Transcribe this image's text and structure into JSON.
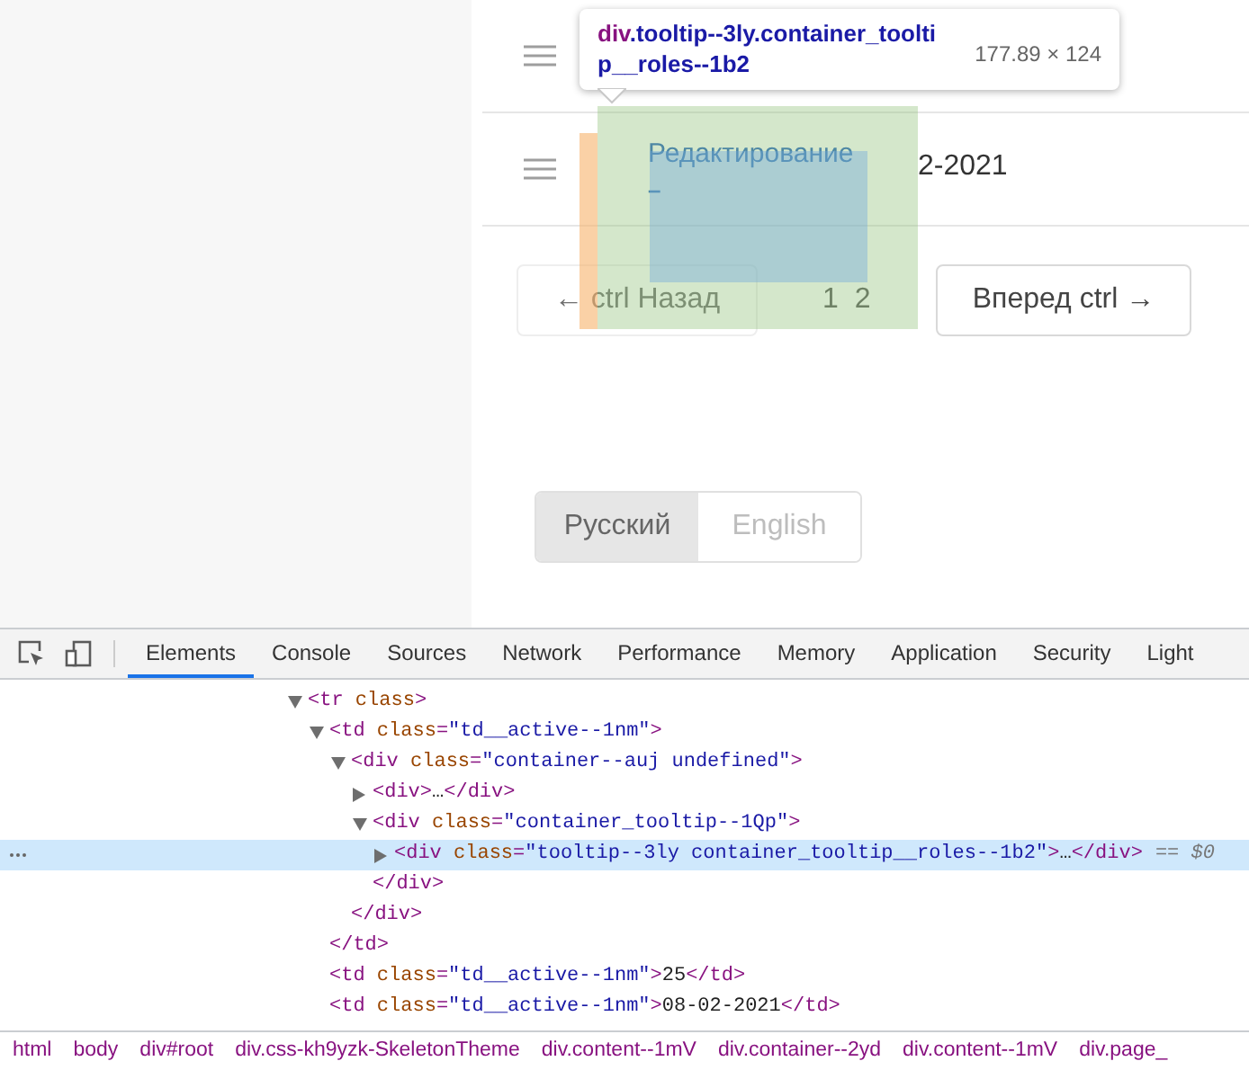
{
  "page": {
    "rows": [
      {
        "cell_title": null,
        "cell_note": null,
        "date_fragment": null
      },
      {
        "cell_title": "Редактирование",
        "cell_note": "–",
        "date_fragment": "2-2021"
      }
    ],
    "pagination": {
      "prev": {
        "label": "← ctrl Назад",
        "disabled": true
      },
      "pages": [
        "1",
        "2"
      ],
      "next": {
        "label": "Вперед ctrl →",
        "disabled": false
      }
    },
    "languages": [
      {
        "label": "Русский",
        "selected": true
      },
      {
        "label": "English",
        "selected": false
      }
    ]
  },
  "inspect_tooltip": {
    "tag": "div",
    "classes": ".tooltip--3ly.container_tooltip__roles--1b2",
    "size": "177.89 × 124"
  },
  "devtools": {
    "tabs": [
      {
        "label": "Elements",
        "selected": true
      },
      {
        "label": "Console",
        "selected": false
      },
      {
        "label": "Sources",
        "selected": false
      },
      {
        "label": "Network",
        "selected": false
      },
      {
        "label": "Performance",
        "selected": false
      },
      {
        "label": "Memory",
        "selected": false
      },
      {
        "label": "Application",
        "selected": false
      },
      {
        "label": "Security",
        "selected": false
      },
      {
        "label": "Light",
        "selected": false
      }
    ],
    "tree": [
      {
        "text": "<tr class>",
        "expanded": true,
        "selected": false,
        "children": [
          {
            "text": "<td class=\"td__active--1nm\">",
            "expanded": true,
            "selected": false,
            "close": "</td>",
            "children": [
              {
                "text": "<div class=\"container--auj undefined\">",
                "expanded": true,
                "selected": false,
                "close": "</div>",
                "children": [
                  {
                    "text": "<div>…</div>",
                    "expanded": false,
                    "selected": false
                  },
                  {
                    "text": "<div class=\"container_tooltip--1Qp\">",
                    "expanded": true,
                    "selected": false,
                    "close": "</div>",
                    "children": [
                      {
                        "text": "<div class=\"tooltip--3ly container_tooltip__roles--1b2\">…</div>",
                        "suffix": "== $0",
                        "expanded": false,
                        "selected": true
                      }
                    ]
                  }
                ]
              }
            ]
          },
          {
            "text": "<td class=\"td__active--1nm\">25</td>",
            "selected": false
          },
          {
            "text": "<td class=\"td__active--1nm\">08-02-2021</td>",
            "selected": false
          }
        ]
      }
    ],
    "breadcrumbs": [
      "html",
      "body",
      "div#root",
      "div.css-kh9yzk-SkeletonTheme",
      "div.content--1mV",
      "div.container--2yd",
      "div.content--1mV",
      "div.page_"
    ]
  }
}
